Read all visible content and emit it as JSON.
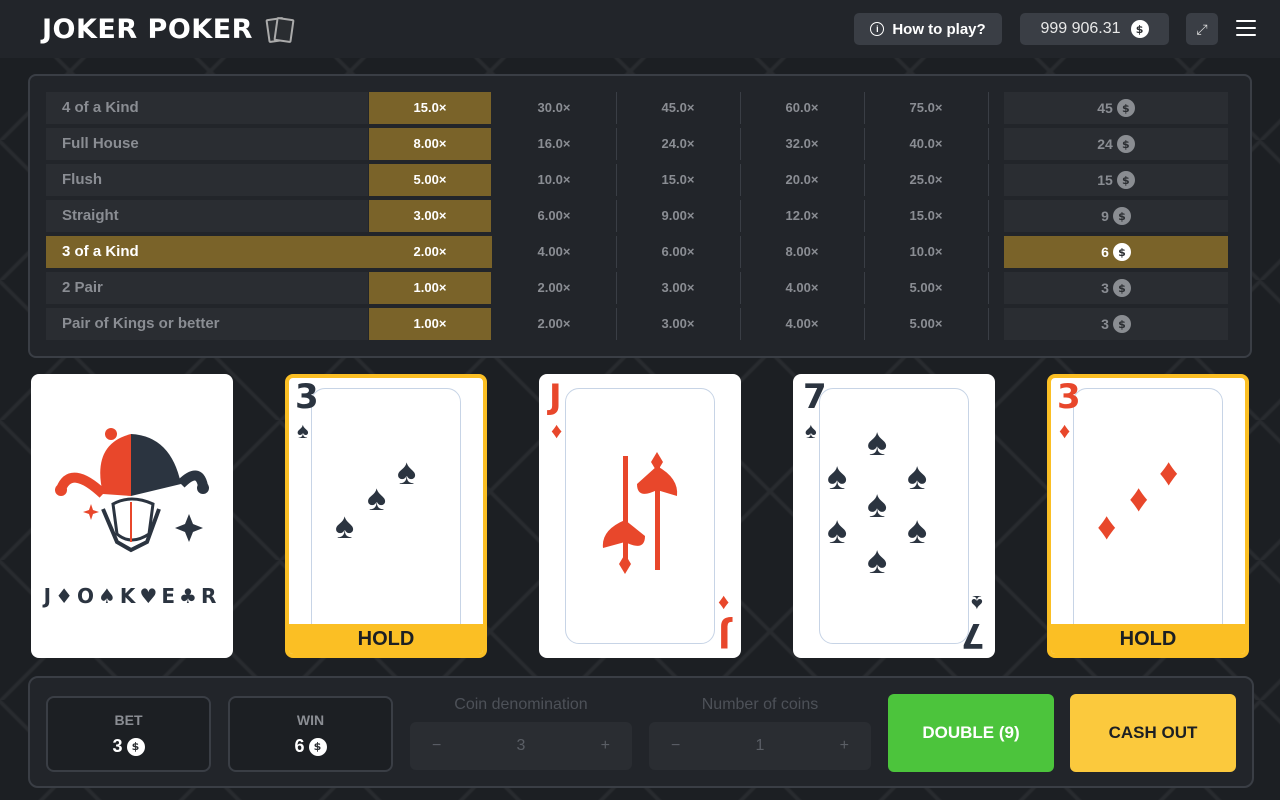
{
  "header": {
    "logo": "JOKER POKER",
    "how_to_play": "How to play?",
    "balance": "999 906.31"
  },
  "paytable": {
    "rows": [
      {
        "name": "4 of a Kind",
        "multipliers": [
          "15.0×",
          "30.0×",
          "45.0×",
          "60.0×",
          "75.0×"
        ],
        "win": "45",
        "active": false
      },
      {
        "name": "Full House",
        "multipliers": [
          "8.00×",
          "16.0×",
          "24.0×",
          "32.0×",
          "40.0×"
        ],
        "win": "24",
        "active": false
      },
      {
        "name": "Flush",
        "multipliers": [
          "5.00×",
          "10.0×",
          "15.0×",
          "20.0×",
          "25.0×"
        ],
        "win": "15",
        "active": false
      },
      {
        "name": "Straight",
        "multipliers": [
          "3.00×",
          "6.00×",
          "9.00×",
          "12.0×",
          "15.0×"
        ],
        "win": "9",
        "active": false
      },
      {
        "name": "3 of a Kind",
        "multipliers": [
          "2.00×",
          "4.00×",
          "6.00×",
          "8.00×",
          "10.0×"
        ],
        "win": "6",
        "active": true
      },
      {
        "name": "2 Pair",
        "multipliers": [
          "1.00×",
          "2.00×",
          "3.00×",
          "4.00×",
          "5.00×"
        ],
        "win": "3",
        "active": false
      },
      {
        "name": "Pair of Kings or better",
        "multipliers": [
          "1.00×",
          "2.00×",
          "3.00×",
          "4.00×",
          "5.00×"
        ],
        "win": "3",
        "active": false
      }
    ]
  },
  "cards": [
    {
      "type": "joker",
      "label": "J♦O♠K♥E♣R",
      "held": false
    },
    {
      "rank": "3",
      "suit": "spades",
      "symbol": "♠",
      "held": true
    },
    {
      "rank": "J",
      "suit": "diamonds",
      "symbol": "♦",
      "held": false
    },
    {
      "rank": "7",
      "suit": "spades",
      "symbol": "♠",
      "held": false
    },
    {
      "rank": "3",
      "suit": "diamonds",
      "symbol": "♦",
      "held": true
    }
  ],
  "hold_label": "HOLD",
  "bottom": {
    "bet_label": "BET",
    "bet_value": "3",
    "win_label": "WIN",
    "win_value": "6",
    "coin_denomination_label": "Coin denomination",
    "coin_denomination_value": "3",
    "number_of_coins_label": "Number of coins",
    "number_of_coins_value": "1",
    "minus": "−",
    "plus": "+",
    "double_label": "DOUBLE (9)",
    "cashout_label": "CASH OUT"
  },
  "currency_symbol": "$",
  "colors": {
    "accent_gold": "#7a6329",
    "hold_yellow": "#fbbf24",
    "double_green": "#4cc43c",
    "cashout_yellow": "#fbc93d",
    "suit_red": "#e8472b"
  }
}
